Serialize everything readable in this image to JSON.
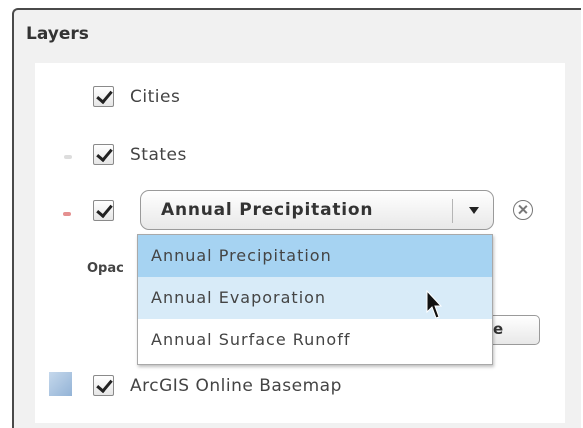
{
  "panel": {
    "title": "Layers"
  },
  "layers": [
    {
      "label": "Cities",
      "checked": true
    },
    {
      "label": "States",
      "checked": true
    },
    {
      "label": "Annual Precipitation",
      "checked": true
    },
    {
      "label": "ArcGIS Online Basemap",
      "checked": true
    }
  ],
  "select": {
    "value": "Annual Precipitation",
    "options": [
      "Annual Precipitation",
      "Annual Evaporation",
      "Annual Surface Runoff"
    ],
    "hovered_option": "Annual Evaporation"
  },
  "opacity": {
    "label": "Opac"
  },
  "icons": {
    "select_arrow": "chevron-down-icon",
    "remove": "remove-circle-icon",
    "cursor": "mouse-cursor-icon",
    "basemap": "basemap-thumbnail-icon"
  },
  "colors": {
    "selected_option": "#a6d3f2",
    "hovered_option": "#d8ebf8",
    "legend_precip": "#e59090",
    "legend_states": "#dddddd"
  }
}
